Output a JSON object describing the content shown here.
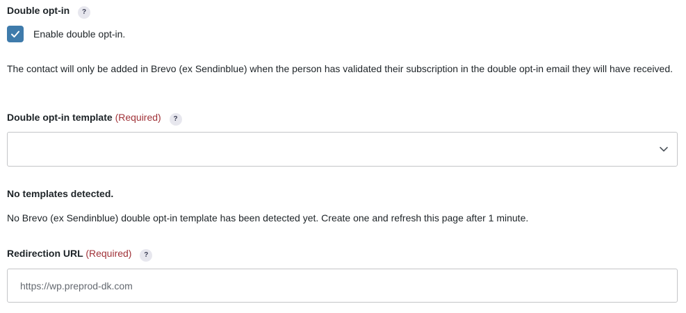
{
  "double_opt_in": {
    "title": "Double opt-in",
    "help": "?",
    "checkbox_checked": true,
    "checkbox_color": "#3f7bab",
    "checkbox_label": "Enable double opt-in.",
    "description": "The contact will only be added in Brevo (ex Sendinblue) when the person has validated their subscription in the double opt-in email they will have received."
  },
  "template": {
    "title": "Double opt-in template",
    "required": "(Required)",
    "help": "?",
    "selected_value": "",
    "icon": "chevron-down-icon"
  },
  "notice": {
    "title": "No templates detected.",
    "text": "No Brevo (ex Sendinblue) double opt-in template has been detected yet. Create one and refresh this page after 1 minute."
  },
  "redirection": {
    "title": "Redirection URL",
    "required": "(Required)",
    "help": "?",
    "value": "",
    "placeholder": "https://wp.preprod-dk.com"
  },
  "colors": {
    "required": "#a03238",
    "help_bg": "#e7e7ee",
    "border": "#c3c4c7"
  }
}
